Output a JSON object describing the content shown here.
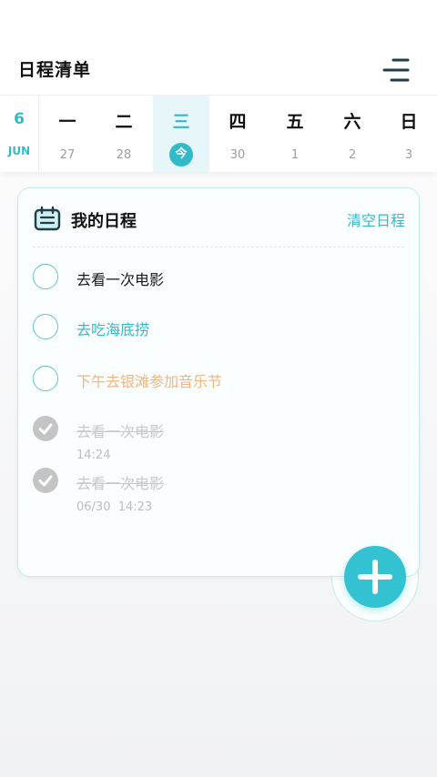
{
  "header": {
    "title": "日程清单",
    "menu_icon": "menu-icon"
  },
  "calendar": {
    "month_number": "6",
    "month_name": "JUN",
    "days": [
      {
        "weekday": "一",
        "date": "27",
        "selected": false
      },
      {
        "weekday": "二",
        "date": "28",
        "selected": false
      },
      {
        "weekday": "三",
        "date": "今",
        "selected": true
      },
      {
        "weekday": "四",
        "date": "30",
        "selected": false
      },
      {
        "weekday": "五",
        "date": "1",
        "selected": false
      },
      {
        "weekday": "六",
        "date": "2",
        "selected": false
      },
      {
        "weekday": "日",
        "date": "3",
        "selected": false
      }
    ],
    "accent_color": "#33b9cc"
  },
  "card": {
    "title": "我的日程",
    "clear_label": "清空日程",
    "icon": "calendar-icon"
  },
  "tasks": [
    {
      "text": "去看一次电影",
      "done": false,
      "color": "#1a1a1a",
      "time": ""
    },
    {
      "text": "去吃海底捞",
      "done": false,
      "color": "#33b9cc",
      "time": ""
    },
    {
      "text": "下午去银滩参加音乐节",
      "done": false,
      "color": "#f4b47a",
      "time": ""
    },
    {
      "text": "去看一次电影",
      "done": true,
      "color": "#c8c8c8",
      "time": "14:24"
    },
    {
      "text": "去看一次电影",
      "done": true,
      "color": "#c8c8c8",
      "time": "06/30  14:23"
    }
  ],
  "fab": {
    "icon": "plus-icon",
    "color": "#33c2d1"
  }
}
